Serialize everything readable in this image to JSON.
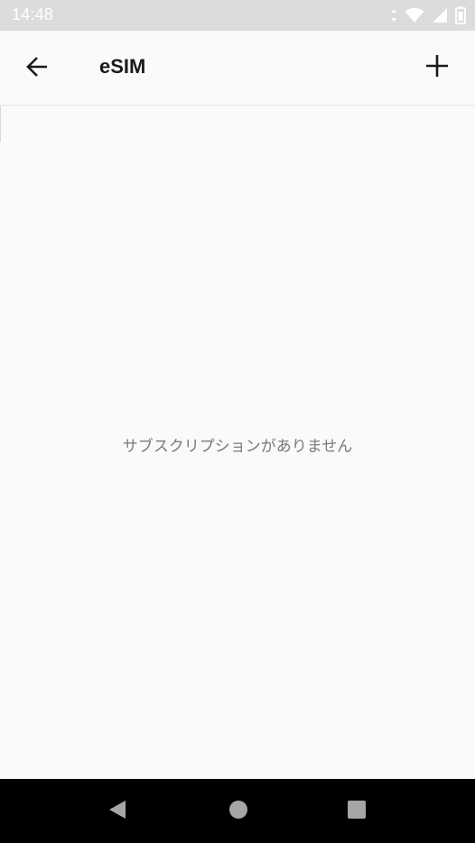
{
  "status_bar": {
    "time": "14:48",
    "icons": [
      "data-arrows-icon",
      "wifi-icon",
      "cell-signal-icon",
      "battery-icon"
    ]
  },
  "toolbar": {
    "title": "eSIM",
    "back_icon": "arrow-left-icon",
    "add_icon": "plus-icon"
  },
  "content": {
    "empty_message": "サブスクリプションがありません"
  },
  "nav_bar": {
    "icons": [
      "nav-back-icon",
      "nav-home-icon",
      "nav-recents-icon"
    ]
  },
  "colors": {
    "status_bar_bg": "#dcdcdc",
    "background": "#fafafa",
    "title": "#1a1a1a",
    "message": "#7a7a7a",
    "nav_bar_bg": "#000000",
    "nav_icon": "#a6a6a6"
  }
}
